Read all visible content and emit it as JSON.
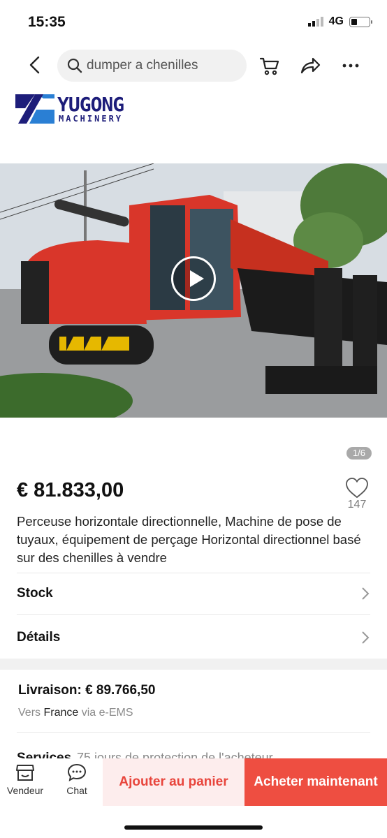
{
  "status_bar": {
    "time": "15:35",
    "network": "4G"
  },
  "search": {
    "placeholder": "dumper a chenilles"
  },
  "logo": {
    "brand": "YUGONG",
    "sub": "MACHINERY"
  },
  "gallery": {
    "counter": "1/6"
  },
  "product": {
    "price": "€ 81.833,00",
    "likes": "147",
    "title": "Perceuse horizontale directionnelle, Machine de pose de tuyaux, équipement de perçage Horizontal directionnel basé sur des chenilles à vendre"
  },
  "rows": {
    "stock": "Stock",
    "details": "Détails"
  },
  "delivery": {
    "label": "Livraison: € 89.766,50",
    "prefix": "Vers",
    "country": "France",
    "via": "via e-EMS"
  },
  "services": {
    "label": "Services",
    "value": "75 jours de protection de l'acheteur"
  },
  "bottom_bar": {
    "vendor": "Vendeur",
    "chat": "Chat",
    "add_to_cart": "Ajouter au panier",
    "buy_now": "Acheter maintenant"
  },
  "colors": {
    "accent": "#ee4e41",
    "accent_light": "#fdeded",
    "brand": "#1d1d7a",
    "machine_red": "#d9362a"
  }
}
